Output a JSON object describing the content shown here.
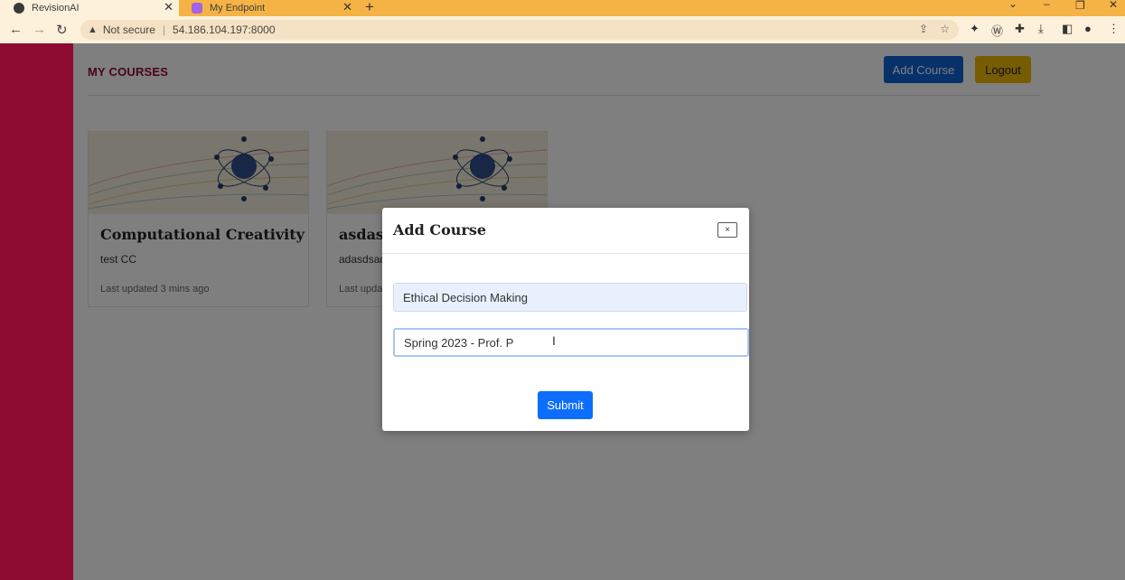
{
  "browser": {
    "tabs": [
      {
        "title": "RevisionAI",
        "favicon": "globe-icon"
      },
      {
        "title": "My Endpoint",
        "favicon": "cube-icon"
      }
    ],
    "security_label": "Not secure",
    "url": "54.186.104.197:8000"
  },
  "header": {
    "title": "MY COURSES",
    "add_course_label": "Add Course",
    "logout_label": "Logout"
  },
  "courses": [
    {
      "title": "Computational Creativity",
      "description": "test CC",
      "updated": "Last updated 3 mins ago"
    },
    {
      "title": "asdasd",
      "description": "adasdsad",
      "updated": "Last upda"
    }
  ],
  "modal": {
    "title": "Add Course",
    "close_label": "×",
    "course_name_value": "Ethical Decision Making",
    "course_desc_value": "Spring 2023 - Prof. P",
    "submit_label": "Submit"
  },
  "colors": {
    "brand": "#8e0b32",
    "primary": "#0d63d7",
    "warning": "#f0b808",
    "browser_tabbar": "#f6b345"
  }
}
